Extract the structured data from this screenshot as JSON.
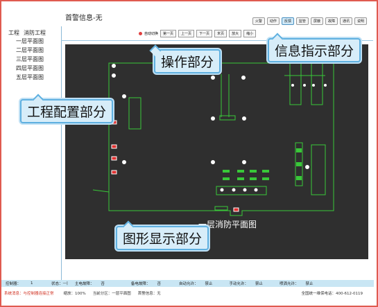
{
  "header": {
    "title": "首警信息-无"
  },
  "status_buttons": [
    "火警",
    "动作",
    "反馈",
    "监管",
    "屏蔽",
    "故障",
    "通讯",
    "说明"
  ],
  "active_status": 2,
  "sidebar": {
    "h1": "工程",
    "h2": "消防工程",
    "items": [
      "一层平面图",
      "二层平面图",
      "三层平面图",
      "四层平面图",
      "五层平面图"
    ]
  },
  "controls": {
    "auto": "自动切换",
    "buttons": [
      "第一页",
      "上一页",
      "下一页",
      "末页",
      "放大",
      "缩小"
    ]
  },
  "canvas": {
    "caption": "一层消防平面图"
  },
  "callouts": {
    "operation": "操作部分",
    "info": "信息指示部分",
    "config": "工程配置部分",
    "graphics": "图形显示部分"
  },
  "status_row": {
    "controller_label": "控制器：",
    "controller_value": "1",
    "state_label": "状态：",
    "state_value": "—|",
    "main_fault_label": "主电故障：",
    "main_fault_value": "否",
    "backup_fault_label": "备电故障：",
    "backup_fault_value": "否",
    "auto_allow_label": "自动允许：",
    "auto_allow_value": "禁止",
    "manual_allow_label": "手动允许：",
    "manual_allow_value": "禁止",
    "spray_allow_label": "喷洒允许：",
    "spray_allow_value": "禁止"
  },
  "info_row": {
    "system_msg": "系统消息：与控制器连接正常",
    "zoom": "缩放：100%",
    "current_zone": "当前分区：一层平面图",
    "first_alarm": "首警信息：无",
    "hotline": "全国统一维保电话：400-612-0119"
  },
  "colors": {
    "accent": "#5fb0e0",
    "alarm": "#d03020",
    "canvas_bg": "#2f2f2f",
    "line": "#39c839"
  }
}
